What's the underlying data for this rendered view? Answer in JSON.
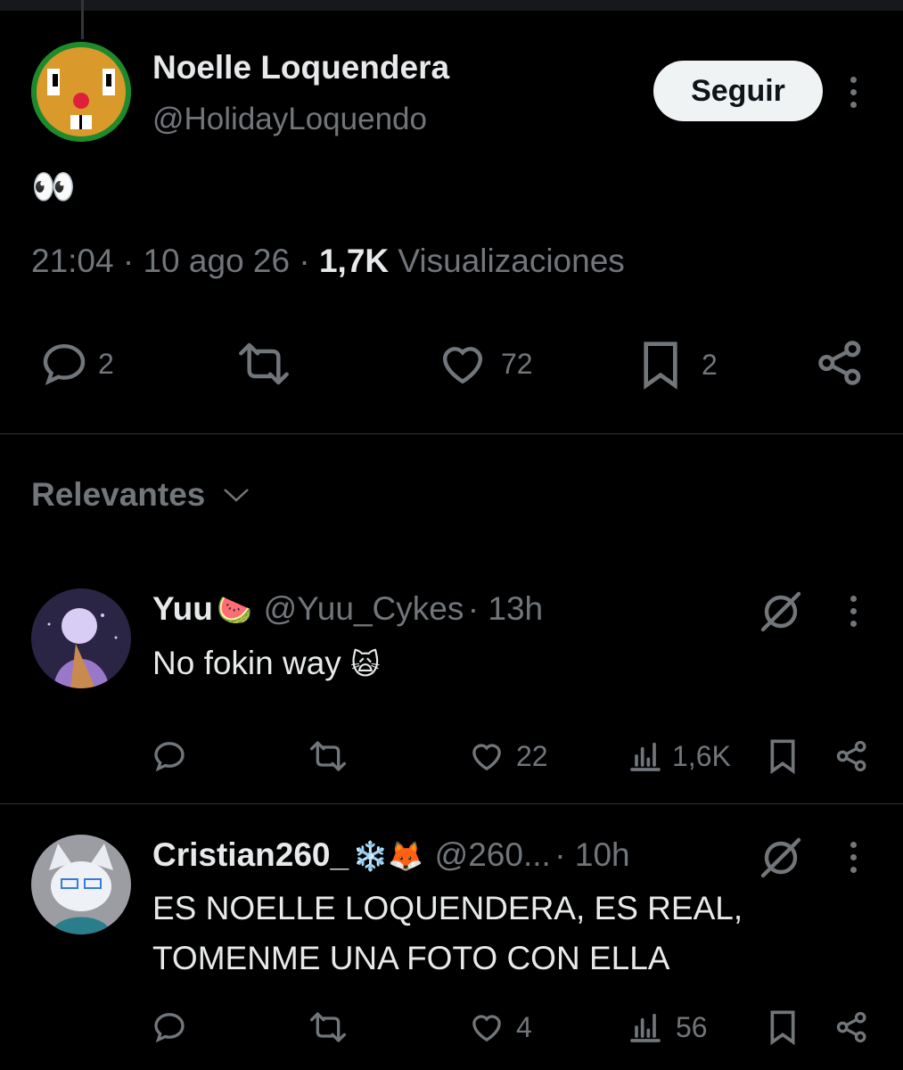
{
  "tweet": {
    "author_name": "Noelle Loquendera",
    "author_handle": "@HolidayLoquendo",
    "follow_label": "Seguir",
    "text": "👀",
    "time": "21:04",
    "date": "10 ago 26",
    "views_count": "1,7K",
    "views_label": "Visualizaciones",
    "replies": "2",
    "likes": "72",
    "bookmarks": "2"
  },
  "sort": {
    "label": "Relevantes"
  },
  "replies": [
    {
      "name": "Yuu",
      "name_emoji": "🍉",
      "handle": "@Yuu_Cykes",
      "time": "13h",
      "text": "No fokin way",
      "text_emoji": "🙀",
      "likes": "22",
      "views": "1,6K"
    },
    {
      "name": "Cristian260_",
      "name_emoji": "❄️🦊",
      "handle": "@260...",
      "time": "10h",
      "text_line1": "ES NOELLE LOQUENDERA, ES REAL,",
      "text_line2": "TOMENME UNA FOTO CON ELLA",
      "likes": "4",
      "views": "56"
    }
  ],
  "colors": {
    "background": "#000000",
    "text": "#e7e9ea",
    "muted": "#71767b",
    "divider": "#2f3336"
  }
}
